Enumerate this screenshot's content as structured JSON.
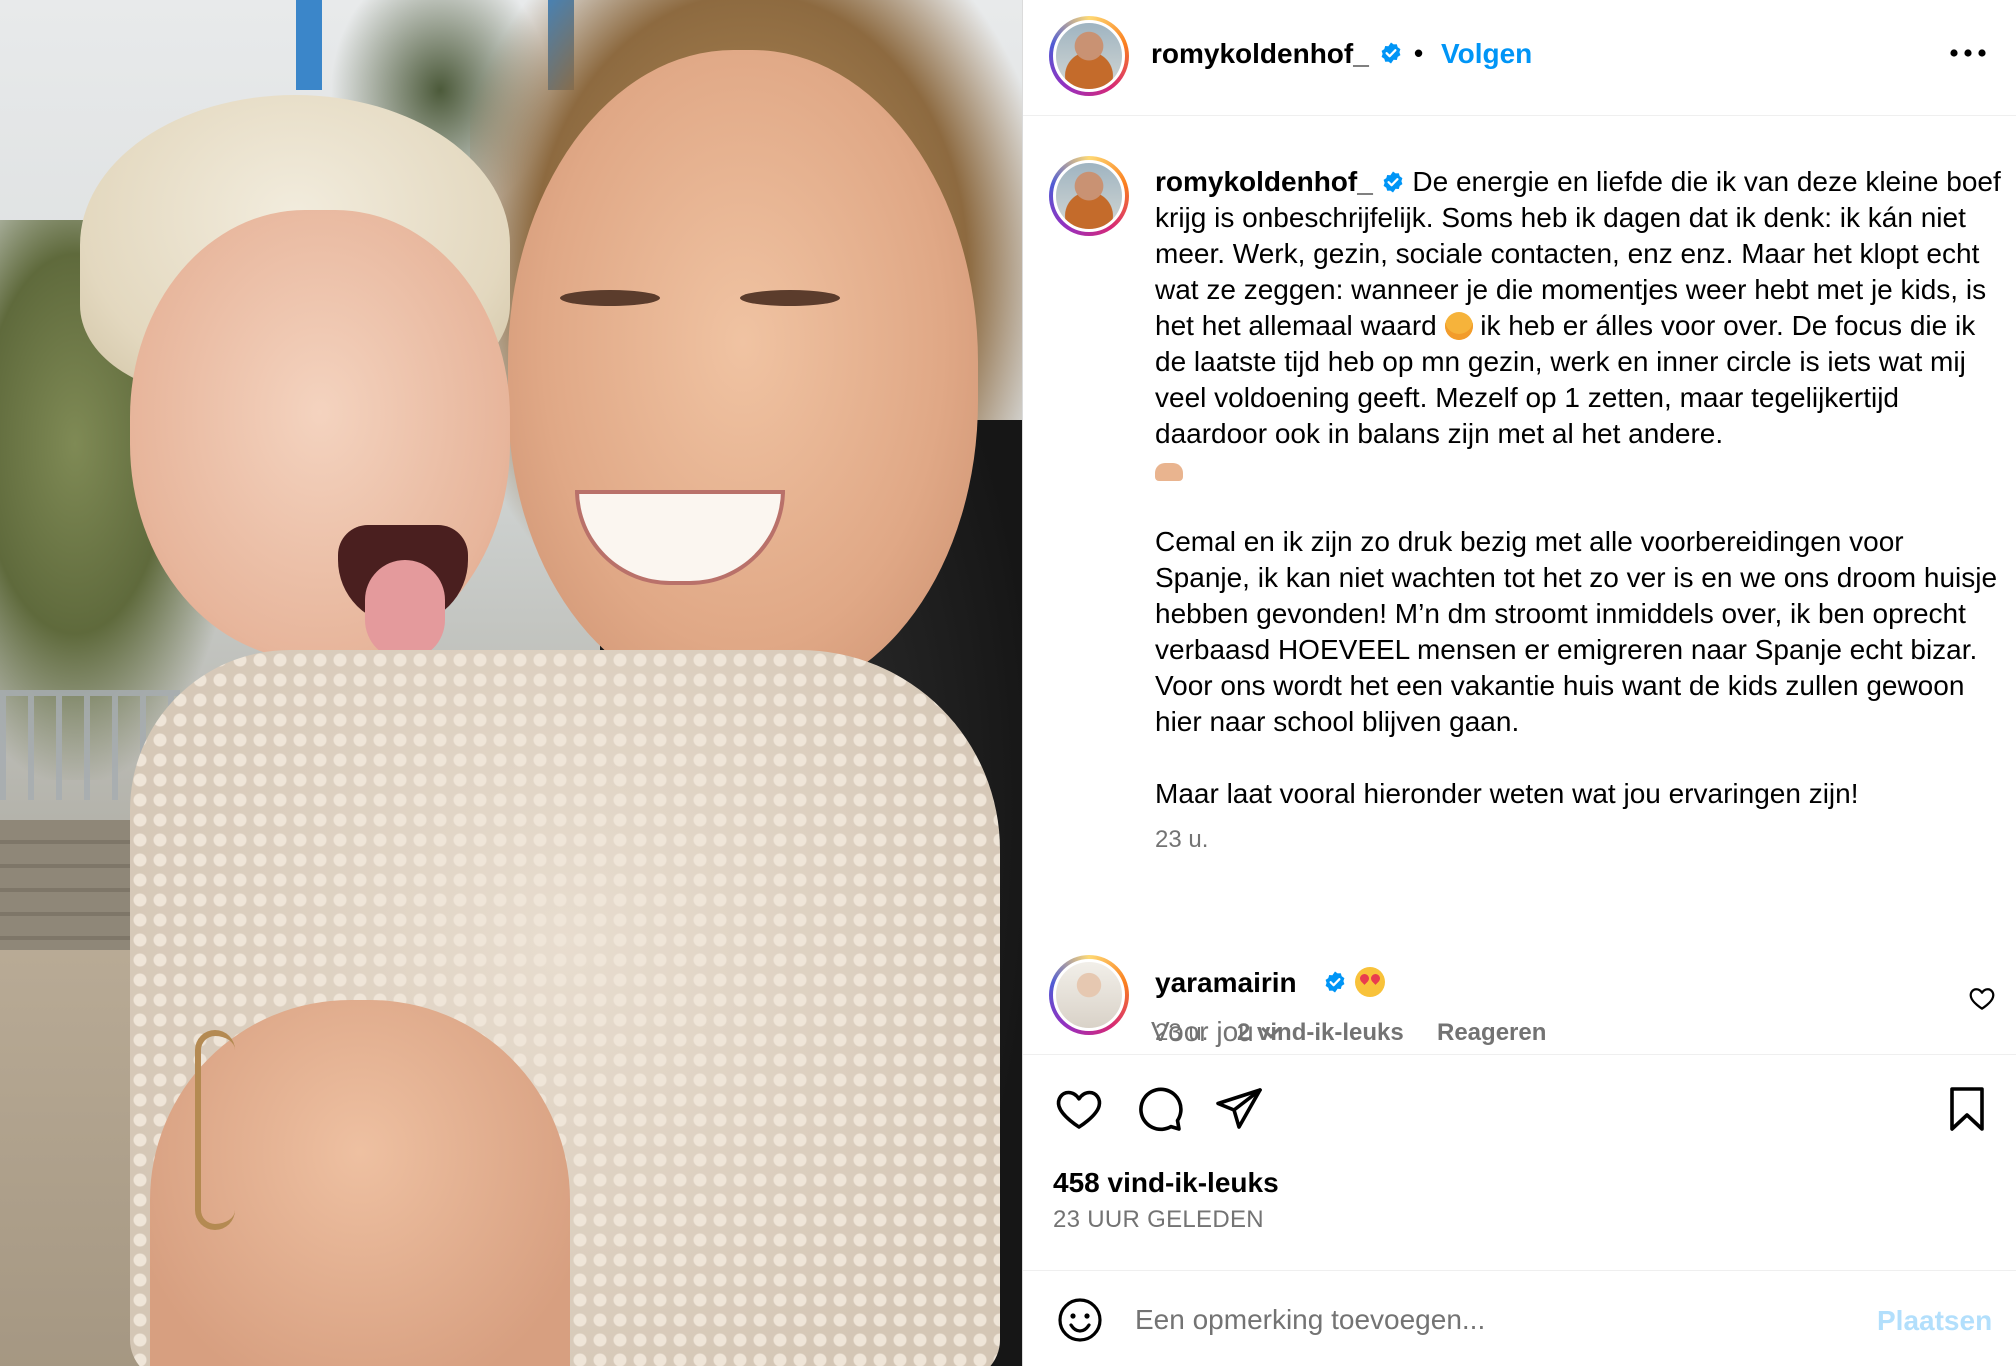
{
  "post": {
    "username": "romykoldenhof_",
    "follow_label": "Volgen",
    "separator": "•",
    "caption_line1": "De energie en liefde die ik van deze kleine boef krijg is onbeschrijfelijk. Soms heb ik dagen dat ik denk: ik kán niet meer. Werk, gezin, sociale contacten, enz enz. Maar het klopt echt wat ze zeggen: wanneer je die momentjes weer hebt met je kids, is het het allemaal waard",
    "caption_line2": "ik heb er álles voor over. De focus die ik de laatste tijd heb op mn gezin, werk en inner circle is iets wat mij veel voldoening geeft. Mezelf op 1 zetten, maar tegelijkertijd daardoor ook in balans zijn met al het andere.",
    "caption_para2": "Cemal en ik zijn zo druk bezig met alle voorbereidingen voor Spanje, ik kan niet wachten tot het zo ver is en we ons droom huisje hebben gevonden! M’n dm stroomt inmiddels over, ik ben oprecht verbaasd HOEVEEL mensen er emigreren naar Spanje echt bizar. Voor ons wordt het een vakantie huis want de kids zullen gewoon hier naar school blijven gaan.",
    "caption_para3": "Maar laat vooral hieronder weten wat jou ervaringen zijn!",
    "caption_time": "23 u.",
    "for_you_label": "Voor jou",
    "likes": "458 vind-ik-leuks",
    "posted_ago": "23 UUR GELEDEN"
  },
  "comment": {
    "username": "yaramairin",
    "emoji": "heart-eyes-emoji",
    "time": "23 u.",
    "likes": "2 vind-ik-leuks",
    "reply_label": "Reageren"
  },
  "add_comment": {
    "placeholder": "Een opmerking toevoegen...",
    "post_label": "Plaatsen"
  },
  "colors": {
    "link_blue": "#0095f6",
    "verified_blue": "#0095f6",
    "muted_text": "#737373",
    "disabled_blue": "#b2dffc"
  },
  "icons": [
    "verified-badge-icon",
    "more-options-icon",
    "heart-icon",
    "comment-icon",
    "share-icon",
    "bookmark-icon",
    "smile-icon",
    "chevron-down-icon"
  ]
}
